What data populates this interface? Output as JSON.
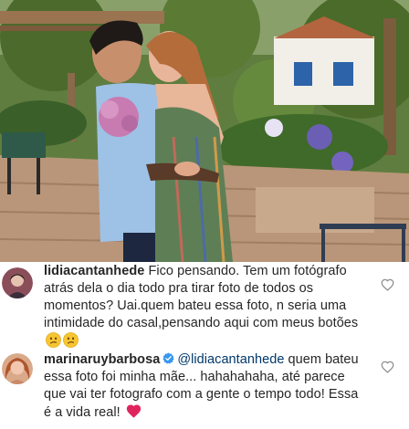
{
  "post": {
    "photo_icon": "couple-photo"
  },
  "comments": [
    {
      "username": "lidiacantanhede",
      "text": "Fico pensando. Tem um fotógrafo atrás dela o dia todo pra tirar foto de todos os momentos?  Uai.quem bateu essa foto, n seria uma intimidade do casal,pensando aqui com meus botões",
      "emojis": [
        "confused-face-icon",
        "confused-face-icon"
      ],
      "like_icon": "heart-outline-icon"
    },
    {
      "username": "marinaruybarbosa",
      "verified_icon": "verified-badge-icon",
      "mention": "@lidiacantanhede",
      "text": " quem bateu essa foto foi minha mãe... hahahahaha, até parece que vai ter fotografo com a gente o tempo todo! Essa é a vida real!",
      "emojis": [
        "red-heart-icon"
      ],
      "like_icon": "heart-outline-icon"
    }
  ],
  "colors": {
    "text": "#262626",
    "mention": "#00376b",
    "verified": "#3897f0",
    "heart": "#e0245e"
  }
}
